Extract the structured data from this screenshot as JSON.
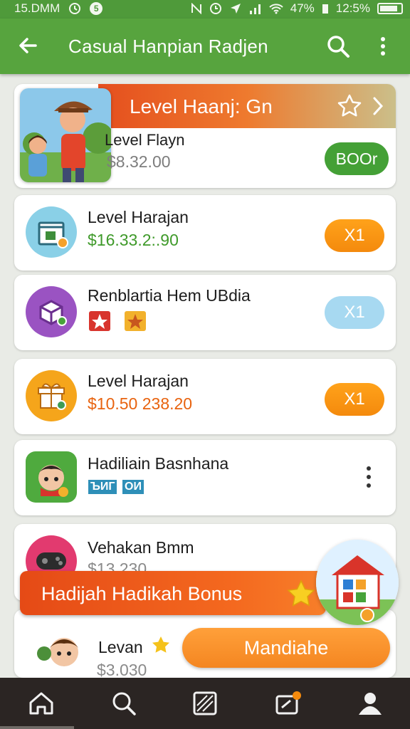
{
  "status_bar": {
    "left_text": "15.DMM",
    "circle_badge": "5",
    "battery_text": "47%",
    "time": "12:5%"
  },
  "app_bar": {
    "title": "Casual Hanpian Radjen"
  },
  "featured": {
    "banner": "Level Haanj: Gn",
    "title": "Level Flayn",
    "price": "$8.32.00",
    "button": "BOOr"
  },
  "rows": [
    {
      "title": "Level Harajan",
      "price": "$16.33.2:.90",
      "button": "X1"
    },
    {
      "title": "Renblartia Hem UBdia",
      "button": "X1"
    },
    {
      "title": "Level Harajan",
      "price": "$10.50 238.20",
      "button": "X1"
    },
    {
      "title": "Hadiliain Basnhana",
      "tags": [
        "ЪИГ",
        "ОИ"
      ]
    },
    {
      "title": "Vehakan Bmm",
      "price": "$13.230"
    }
  ],
  "bonus": {
    "label": "Hadijah Hadikah Bonus"
  },
  "last_item": {
    "title": "Levan",
    "price": "$3.030",
    "button": "Mandiahe"
  },
  "colors": {
    "app_bar": "#57a43e",
    "price_green": "#3f9a2a",
    "price_orange": "#e8630f",
    "accent_orange": "#f48a0d"
  },
  "icons": {
    "app_bar": [
      "back-arrow-icon",
      "search-icon",
      "more-vert-icon"
    ],
    "nav": [
      "home-icon",
      "search-icon",
      "gallery-icon",
      "inbox-icon",
      "profile-icon"
    ]
  }
}
